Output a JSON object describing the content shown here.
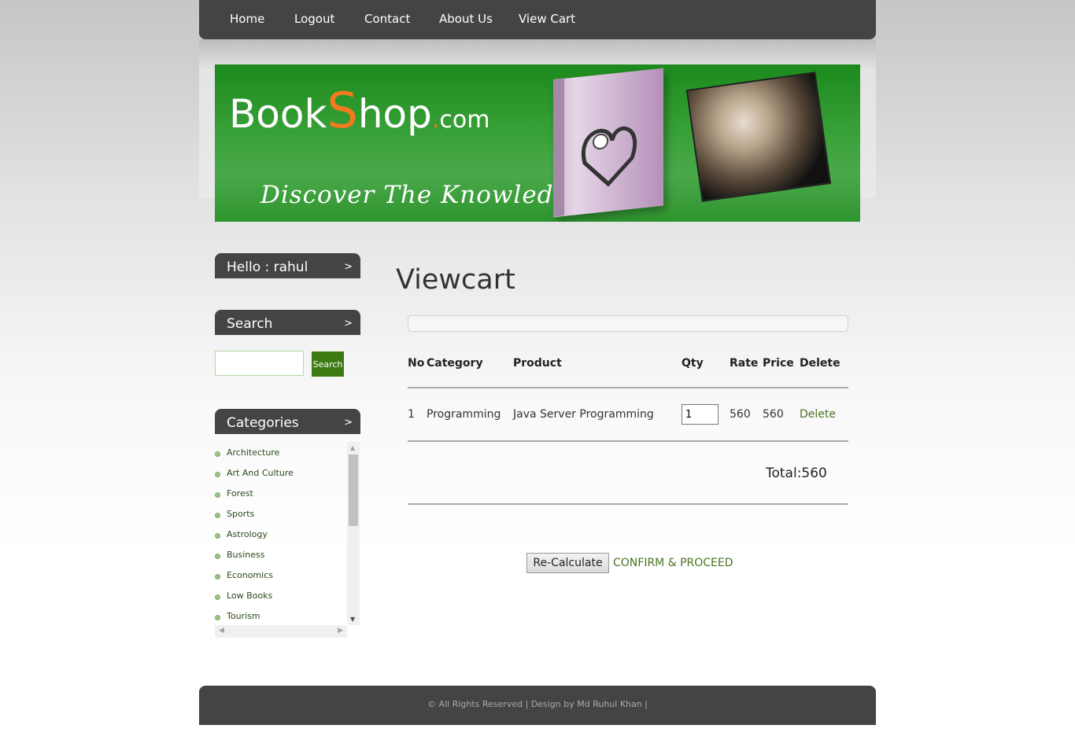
{
  "nav": {
    "home": "Home",
    "logout": "Logout",
    "contact": "Contact",
    "about": "About Us",
    "view_cart": "View Cart"
  },
  "banner": {
    "logo_book": "Book",
    "logo_s": "S",
    "logo_hop": "hop",
    "logo_dot": ".",
    "logo_com": "com",
    "tagline": "Discover The Knowledge"
  },
  "sidebar": {
    "hello": "Hello : rahul",
    "search_title": "Search",
    "search_button": "Search",
    "search_value": "",
    "categories_title": "Categories",
    "arrow": ">",
    "categories": [
      "Architecture",
      "Art And Culture",
      "Forest",
      "Sports",
      "Astrology",
      "Business",
      "Economics",
      "Low Books",
      "Tourism"
    ]
  },
  "main": {
    "title": "Viewcart",
    "headers": {
      "no": "No",
      "category": "Category",
      "product": "Product",
      "qty": "Qty",
      "rate": "Rate",
      "price": "Price",
      "delete": "Delete"
    },
    "row": {
      "no": "1",
      "category": "Programming",
      "product": "Java Server Programming",
      "qty": "1",
      "rate": "560",
      "price": "560",
      "delete": "Delete"
    },
    "total": "Total:560",
    "recalculate": "Re-Calculate",
    "confirm": "CONFIRM & PROCEED"
  },
  "footer": {
    "text": "© All Rights Reserved | Design by Md Ruhul Khan |"
  },
  "colors": {
    "nav_bg": "#444444",
    "banner_green": "#2e942e",
    "accent_orange": "#f47a1f",
    "link_green": "#4a7320",
    "search_button": "#3c7a12"
  }
}
